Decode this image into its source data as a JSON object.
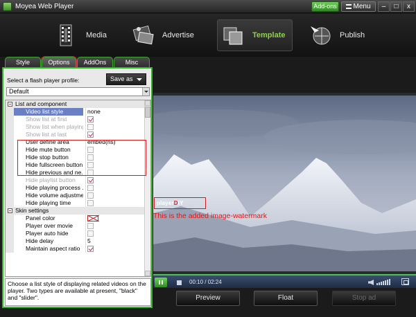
{
  "window": {
    "title": "Moyea Web Player",
    "addons_label": "Add-ons",
    "menu_label": "Menu",
    "minimize_label": "–",
    "maximize_label": "□",
    "close_label": "x"
  },
  "toolbar": {
    "items": [
      {
        "label": "Media",
        "icon": "film-icon",
        "active": false
      },
      {
        "label": "Advertise",
        "icon": "advertise-icon",
        "active": false
      },
      {
        "label": "Template",
        "icon": "template-icon",
        "active": true
      },
      {
        "label": "Publish",
        "icon": "publish-icon",
        "active": false
      }
    ],
    "active_color": "#8fd34a"
  },
  "tabs": [
    {
      "label": "Style",
      "active": false
    },
    {
      "label": "Options",
      "active": true
    },
    {
      "label": "AddOns",
      "active": false
    },
    {
      "label": "Misc",
      "active": false
    }
  ],
  "profile": {
    "label": "Select a flash player profile:",
    "save_as_label": "Save as",
    "selected": "Default"
  },
  "properties": {
    "categories": [
      {
        "name": "List and component",
        "rows": [
          {
            "name": "Video list style",
            "type": "text",
            "value": "none",
            "selected": true
          },
          {
            "name": "Show list at first",
            "type": "check",
            "checked": true,
            "disabled": true
          },
          {
            "name": "Show list when playing",
            "type": "check",
            "checked": false,
            "disabled": true
          },
          {
            "name": "Show list at last",
            "type": "check",
            "checked": true,
            "disabled": true
          },
          {
            "name": "User define area",
            "type": "text",
            "value": "embed(hs)"
          },
          {
            "name": "Hide mute button",
            "type": "check",
            "checked": false
          },
          {
            "name": "Hide stop button",
            "type": "check",
            "checked": false
          },
          {
            "name": "Hide fullscreen button",
            "type": "check",
            "checked": false
          },
          {
            "name": "Hide previous and ne...",
            "type": "check",
            "checked": false
          },
          {
            "name": "Hide playlist button",
            "type": "check",
            "checked": true,
            "disabled": true
          },
          {
            "name": "Hide playing process ...",
            "type": "check",
            "checked": false
          },
          {
            "name": "Hide volume adjustme...",
            "type": "check",
            "checked": false
          },
          {
            "name": "Hide playing time",
            "type": "check",
            "checked": false
          }
        ]
      },
      {
        "name": "Skin settings",
        "rows": [
          {
            "name": "Panel color",
            "type": "swatch",
            "value": "none"
          },
          {
            "name": "Player over movie",
            "type": "check",
            "checked": false
          },
          {
            "name": "Player auto hide",
            "type": "check",
            "checked": false
          },
          {
            "name": "Hide delay",
            "type": "text",
            "value": "5"
          },
          {
            "name": "Maintain aspect ratio",
            "type": "check",
            "checked": true
          }
        ]
      }
    ],
    "description": "Choose a list style of displaying related videos on the player. Two types are available at present, \"black\" and \"slider\"."
  },
  "preview": {
    "watermark_logo_text": "playerDiY",
    "watermark_caption": "This is the added image-watermark",
    "caption_color": "#e01818"
  },
  "player": {
    "time": "00:10 / 02:24",
    "progress_fraction": 0.07,
    "accent_color": "#4ec24a"
  },
  "buttons": {
    "preview_label": "Preview",
    "float_label": "Float",
    "stop_ad_label": "Stop ad"
  }
}
